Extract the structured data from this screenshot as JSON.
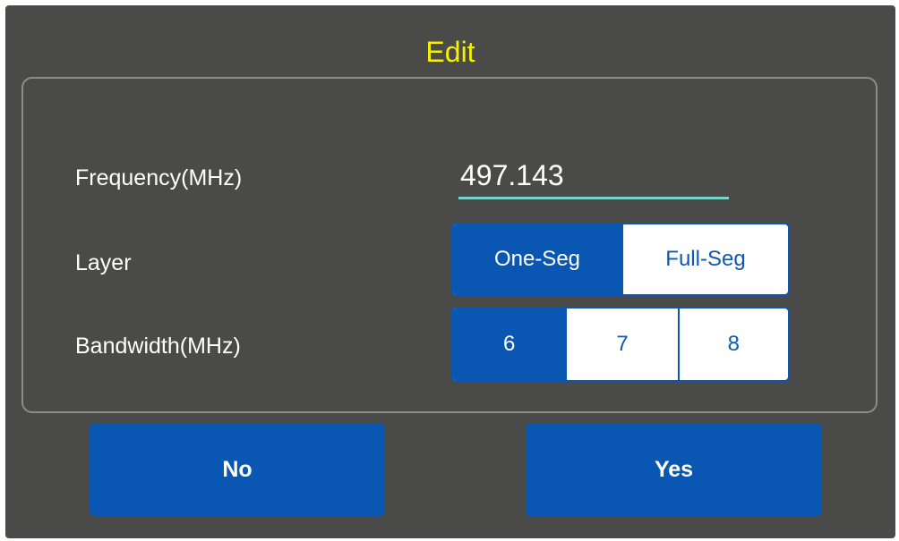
{
  "dialog": {
    "title": "Edit",
    "title_color": "#f4f000"
  },
  "frequency": {
    "label": "Frequency(MHz)",
    "value": "497.143"
  },
  "layer": {
    "label": "Layer",
    "options": [
      "One-Seg",
      "Full-Seg"
    ],
    "selected": "One-Seg"
  },
  "bandwidth": {
    "label": "Bandwidth(MHz)",
    "options": [
      "6",
      "7",
      "8"
    ],
    "selected": "6"
  },
  "buttons": {
    "no_label": "No",
    "yes_label": "Yes"
  },
  "colors": {
    "dialog_bg": "#4a4b49",
    "accent_blue": "#0a57b3",
    "input_underline": "#79d3c8"
  }
}
